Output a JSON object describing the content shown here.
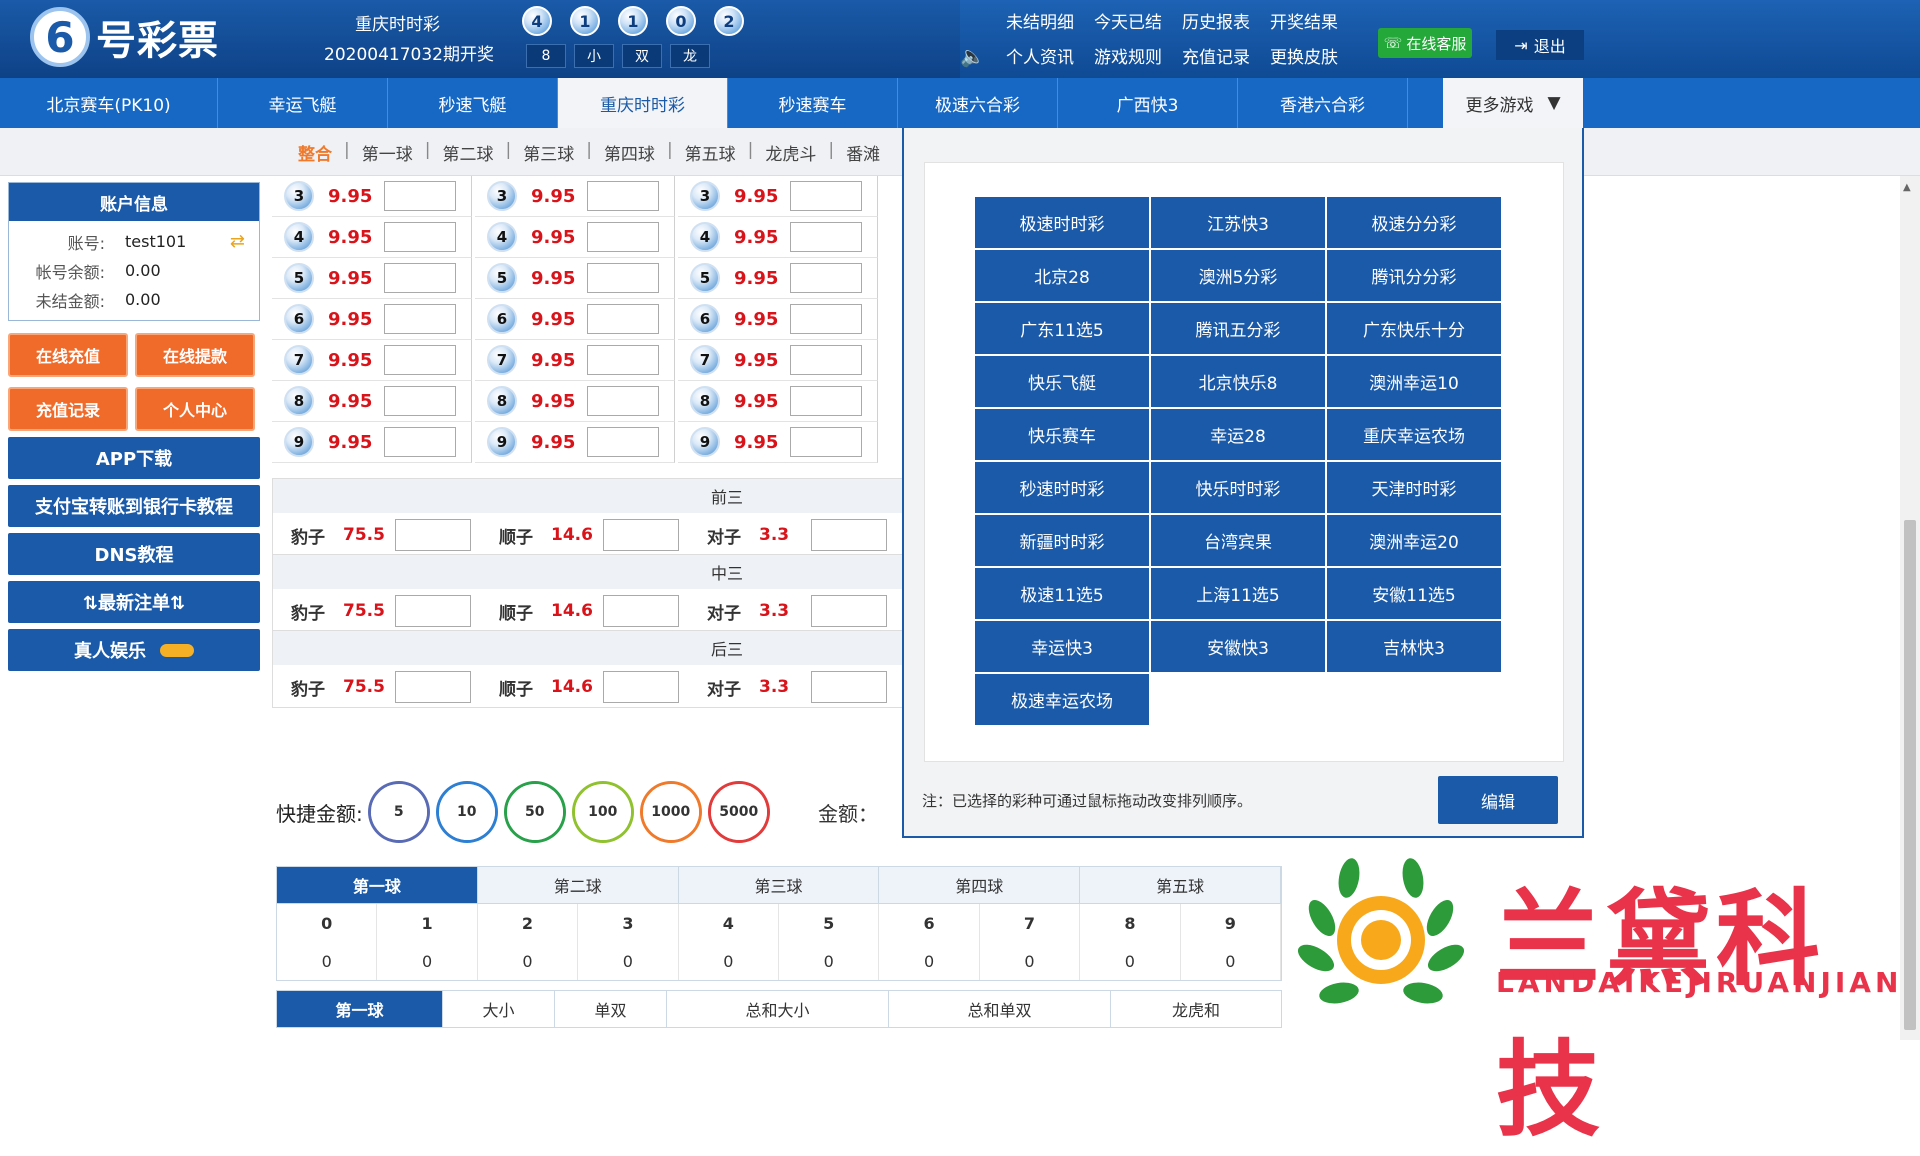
{
  "header": {
    "logo_mark": "6",
    "logo_text": "号彩票",
    "lottery_name": "重庆时时彩",
    "period": "20200417032期开奖",
    "balls": [
      "4",
      "1",
      "1",
      "0",
      "2"
    ],
    "attrs": [
      "8",
      "小",
      "双",
      "龙"
    ],
    "links": [
      "未结明细",
      "今天已结",
      "历史报表",
      "开奖结果",
      "个人资讯",
      "游戏规则",
      "充值记录",
      "更换皮肤"
    ],
    "customer_service": "在线客服",
    "logout": "退出"
  },
  "nav": {
    "items": [
      "北京赛车(PK10)",
      "幸运飞艇",
      "秒速飞艇",
      "重庆时时彩",
      "秒速赛车",
      "极速六合彩",
      "广西快3",
      "香港六合彩"
    ],
    "more": "更多游戏"
  },
  "subtabs": [
    "整合",
    "第一球",
    "第二球",
    "第三球",
    "第四球",
    "第五球",
    "龙虎斗",
    "番滩"
  ],
  "account": {
    "title": "账户信息",
    "account_label": "账号:",
    "account_value": "test101",
    "balance_label": "帐号余额:",
    "balance_value": "0.00",
    "unsettled_label": "未结金额:",
    "unsettled_value": "0.00"
  },
  "sidebar_orange": [
    "在线充值",
    "在线提款",
    "充值记录",
    "个人中心"
  ],
  "sidebar_blue": [
    "APP下载",
    "支付宝转账到银行卡教程",
    "DNS教程",
    "⇅最新注单⇅",
    "真人娱乐"
  ],
  "ball_rows": [
    {
      "num": "3",
      "odds": "9.95"
    },
    {
      "num": "4",
      "odds": "9.95"
    },
    {
      "num": "5",
      "odds": "9.95"
    },
    {
      "num": "6",
      "odds": "9.95"
    },
    {
      "num": "7",
      "odds": "9.95"
    },
    {
      "num": "8",
      "odds": "9.95"
    },
    {
      "num": "9",
      "odds": "9.95"
    }
  ],
  "groups": [
    {
      "title": "前三",
      "baozi": "豹子",
      "baozi_odds": "75.5",
      "shunzi": "顺子",
      "shunzi_odds": "14.6",
      "duizi": "对子",
      "duizi_odds": "3.3"
    },
    {
      "title": "中三",
      "baozi": "豹子",
      "baozi_odds": "75.5",
      "shunzi": "顺子",
      "shunzi_odds": "14.6",
      "duizi": "对子",
      "duizi_odds": "3.3"
    },
    {
      "title": "后三",
      "baozi": "豹子",
      "baozi_odds": "75.5",
      "shunzi": "顺子",
      "shunzi_odds": "14.6",
      "duizi": "对子",
      "duizi_odds": "3.3"
    }
  ],
  "quick": {
    "label": "快捷金额:",
    "chips": [
      "5",
      "10",
      "50",
      "100",
      "1000",
      "5000"
    ],
    "amount_label": "金额："
  },
  "results": {
    "tabs": [
      "第一球",
      "第二球",
      "第三球",
      "第四球",
      "第五球"
    ],
    "digits": [
      "0",
      "1",
      "2",
      "3",
      "4",
      "5",
      "6",
      "7",
      "8",
      "9"
    ],
    "counts": [
      "0",
      "0",
      "0",
      "0",
      "0",
      "0",
      "0",
      "0",
      "0",
      "0"
    ],
    "tabs2": [
      "第一球",
      "大小",
      "单双",
      "总和大小",
      "总和单双",
      "龙虎和"
    ]
  },
  "popup": {
    "games": [
      "极速时时彩",
      "江苏快3",
      "极速分分彩",
      "北京28",
      "澳洲5分彩",
      "腾讯分分彩",
      "广东11选5",
      "腾讯五分彩",
      "广东快乐十分",
      "快乐飞艇",
      "北京快乐8",
      "澳洲幸运10",
      "快乐赛车",
      "幸运28",
      "重庆幸运农场",
      "秒速时时彩",
      "快乐时时彩",
      "天津时时彩",
      "新疆时时彩",
      "台湾宾果",
      "澳洲幸运20",
      "极速11选5",
      "上海11选5",
      "安徽11选5",
      "幸运快3",
      "安徽快3",
      "吉林快3",
      "极速幸运农场"
    ],
    "note": "注：已选择的彩种可通过鼠标拖动改变排列顺序。",
    "edit": "编辑"
  },
  "watermark": {
    "text": "兰黛科技",
    "sub": "LANDAIKEJIRUANJIAN"
  },
  "colors": {
    "brand": "#1a5aa8",
    "accent_orange": "#f06b2a",
    "odds_red": "#d8141a",
    "watermark": "#e8334a"
  }
}
